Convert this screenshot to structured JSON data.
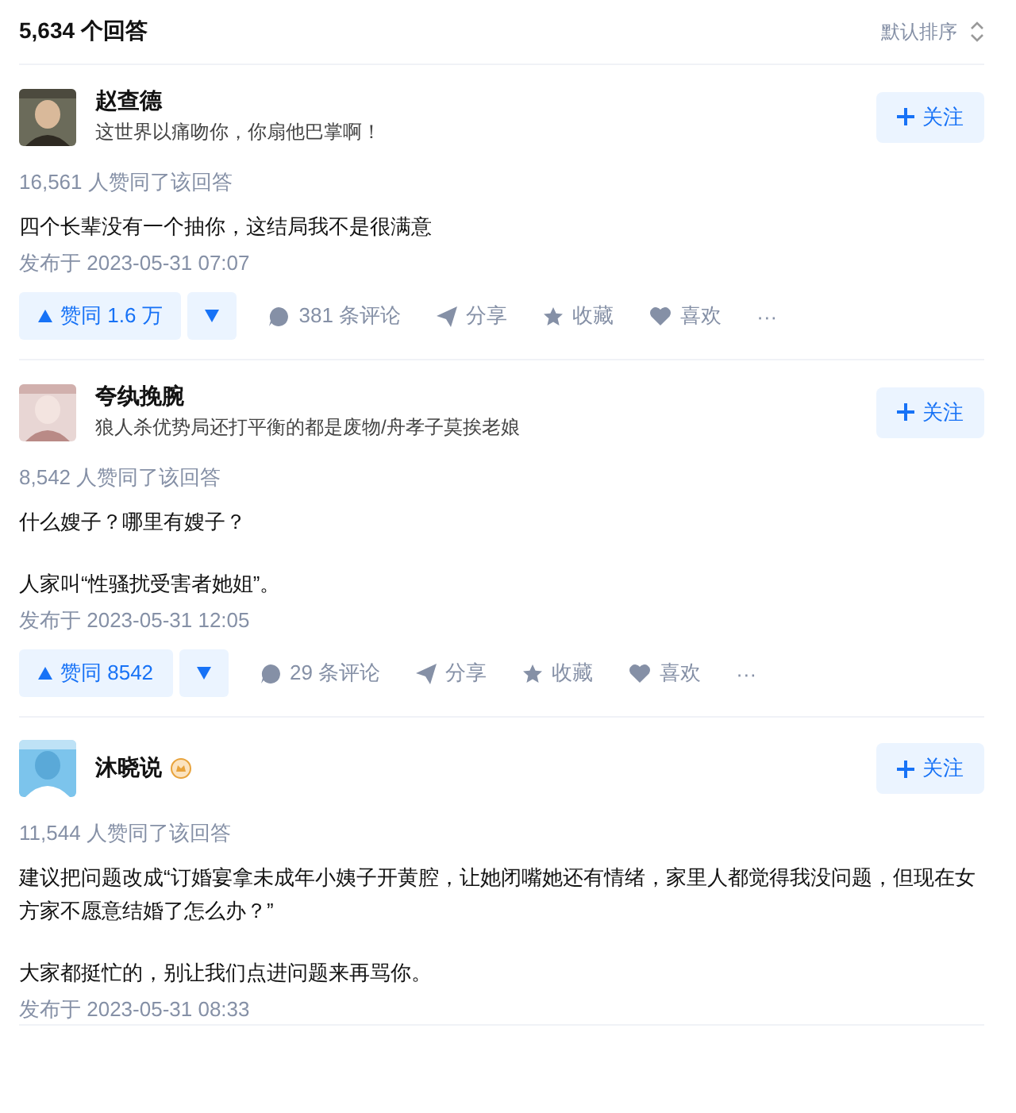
{
  "header": {
    "count": "5,634 个回答",
    "sort": "默认排序"
  },
  "answers": [
    {
      "author": "赵查德",
      "bio": "这世界以痛吻你，你扇他巴掌啊！",
      "badge": false,
      "follow": "关注",
      "likes": "16,561 人赞同了该回答",
      "paragraphs": [
        "四个长辈没有一个抽你，这结局我不是很满意"
      ],
      "date": "发布于 2023-05-31 07:07",
      "vote": "赞同 1.6 万",
      "comments": "381 条评论",
      "share": "分享",
      "collect": "收藏",
      "like": "喜欢",
      "more": "···"
    },
    {
      "author": "夸纨挽腕",
      "bio": "狼人杀优势局还打平衡的都是废物/舟孝子莫挨老娘",
      "badge": false,
      "follow": "关注",
      "likes": "8,542 人赞同了该回答",
      "paragraphs": [
        "什么嫂子？哪里有嫂子？",
        "人家叫“性骚扰受害者她姐”。"
      ],
      "date": "发布于 2023-05-31 12:05",
      "vote": "赞同 8542",
      "comments": "29 条评论",
      "share": "分享",
      "collect": "收藏",
      "like": "喜欢",
      "more": "···"
    },
    {
      "author": "沐晓说",
      "badge": true,
      "follow": "关注",
      "likes": "11,544 人赞同了该回答",
      "paragraphs": [
        "建议把问题改成“订婚宴拿未成年小姨子开黄腔，让她闭嘴她还有情绪，家里人都觉得我没问题，但现在女方家不愿意结婚了怎么办？”",
        "大家都挺忙的，别让我们点进问题来再骂你。"
      ],
      "date": "发布于 2023-05-31 08:33"
    }
  ]
}
